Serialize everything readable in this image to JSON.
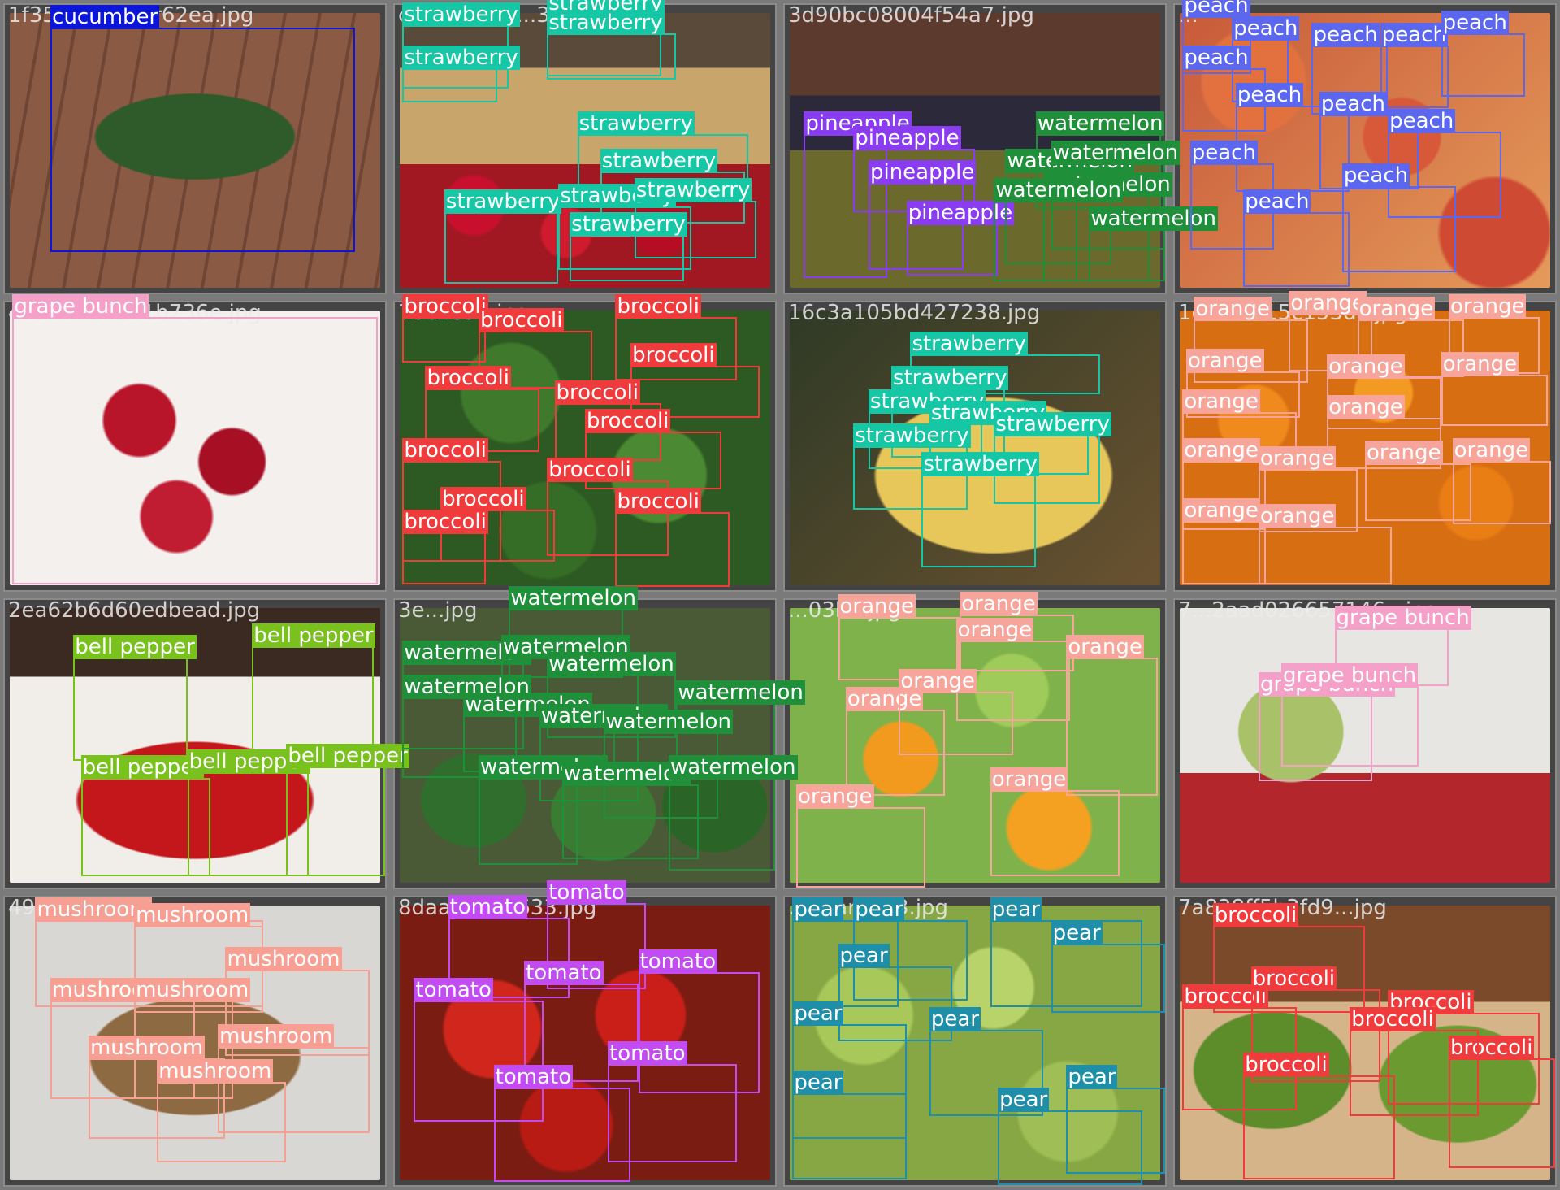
{
  "colors": {
    "cucumber": "#0b16d8",
    "strawberry": "#16c7a6",
    "pineapple": "#8a3cf0",
    "watermelon": "#1f8f3a",
    "peach": "#5b67ef",
    "grape bunch": "#f5a0c8",
    "broccoli": "#ef3b3b",
    "orange": "#f7a49a",
    "bell pepper": "#79c21e",
    "mushroom": "#f79f92",
    "tomato": "#c24cf2",
    "pear": "#1f8ea8"
  },
  "tiles": [
    {
      "filename": "1f35cucumber62ea.jpg",
      "labels": [
        {
          "text": "cucumber",
          "cls": "cucumber"
        }
      ]
    },
    {
      "filename": "c41064a5a...3.jpg",
      "labels": [
        {
          "text": "strawberry",
          "cls": "strawberry"
        },
        {
          "text": "strawberry",
          "cls": "strawberry"
        },
        {
          "text": "strawberry",
          "cls": "strawberry"
        },
        {
          "text": "strawberry",
          "cls": "strawberry"
        },
        {
          "text": "strawberry",
          "cls": "strawberry"
        },
        {
          "text": "strawberry",
          "cls": "strawberry"
        },
        {
          "text": "strawberry",
          "cls": "strawberry"
        },
        {
          "text": "strawberry",
          "cls": "strawberry"
        },
        {
          "text": "strawberry",
          "cls": "strawberry"
        },
        {
          "text": "strawberry",
          "cls": "strawberry"
        }
      ]
    },
    {
      "filename": "3d90bc08004f54a7.jpg",
      "labels": [
        {
          "text": "pineapple",
          "cls": "pineapple"
        },
        {
          "text": "pineapple",
          "cls": "pineapple"
        },
        {
          "text": "pineapple",
          "cls": "pineapple"
        },
        {
          "text": "pineapple",
          "cls": "pineapple"
        },
        {
          "text": "watermelon",
          "cls": "watermelon"
        },
        {
          "text": "watermelon",
          "cls": "watermelon"
        },
        {
          "text": "watermelon",
          "cls": "watermelon"
        },
        {
          "text": "watermelon",
          "cls": "watermelon"
        },
        {
          "text": "watermelon",
          "cls": "watermelon"
        },
        {
          "text": "watermelon",
          "cls": "watermelon"
        }
      ]
    },
    {
      "filename": "...",
      "labels": [
        {
          "text": "peach",
          "cls": "peach"
        },
        {
          "text": "peach",
          "cls": "peach"
        },
        {
          "text": "peach",
          "cls": "peach"
        },
        {
          "text": "peach",
          "cls": "peach"
        },
        {
          "text": "peach",
          "cls": "peach"
        },
        {
          "text": "peach",
          "cls": "peach"
        },
        {
          "text": "peach",
          "cls": "peach"
        },
        {
          "text": "peach",
          "cls": "peach"
        },
        {
          "text": "peach",
          "cls": "peach"
        },
        {
          "text": "peach",
          "cls": "peach"
        },
        {
          "text": "peach",
          "cls": "peach"
        },
        {
          "text": "peach",
          "cls": "peach"
        }
      ]
    },
    {
      "filename": "4a56b7242b1b736e.jpg",
      "labels": [
        {
          "text": "grape bunch",
          "cls": "grape bunch"
        }
      ]
    },
    {
      "filename": "78c2e9...jpg",
      "labels": [
        {
          "text": "broccoli",
          "cls": "broccoli"
        },
        {
          "text": "broccoli",
          "cls": "broccoli"
        },
        {
          "text": "broccoli",
          "cls": "broccoli"
        },
        {
          "text": "broccoli",
          "cls": "broccoli"
        },
        {
          "text": "broccoli",
          "cls": "broccoli"
        },
        {
          "text": "broccoli",
          "cls": "broccoli"
        },
        {
          "text": "broccoli",
          "cls": "broccoli"
        },
        {
          "text": "broccoli",
          "cls": "broccoli"
        },
        {
          "text": "broccoli",
          "cls": "broccoli"
        },
        {
          "text": "broccoli",
          "cls": "broccoli"
        },
        {
          "text": "broccoli",
          "cls": "broccoli"
        },
        {
          "text": "broccoli",
          "cls": "broccoli"
        }
      ]
    },
    {
      "filename": "16c3a105bd427238.jpg",
      "labels": [
        {
          "text": "strawberry",
          "cls": "strawberry"
        },
        {
          "text": "strawberry",
          "cls": "strawberry"
        },
        {
          "text": "strawberry",
          "cls": "strawberry"
        },
        {
          "text": "strawberry",
          "cls": "strawberry"
        },
        {
          "text": "strawberry",
          "cls": "strawberry"
        },
        {
          "text": "strawberry",
          "cls": "strawberry"
        },
        {
          "text": "strawberry",
          "cls": "strawberry"
        }
      ]
    },
    {
      "filename": "1c793bf15c153dc.jpg",
      "labels": [
        {
          "text": "orange",
          "cls": "orange"
        },
        {
          "text": "orange",
          "cls": "orange"
        },
        {
          "text": "orange",
          "cls": "orange"
        },
        {
          "text": "orange",
          "cls": "orange"
        },
        {
          "text": "orange",
          "cls": "orange"
        },
        {
          "text": "orange",
          "cls": "orange"
        },
        {
          "text": "orange",
          "cls": "orange"
        },
        {
          "text": "orange",
          "cls": "orange"
        },
        {
          "text": "orange",
          "cls": "orange"
        },
        {
          "text": "orange",
          "cls": "orange"
        },
        {
          "text": "orange",
          "cls": "orange"
        },
        {
          "text": "orange",
          "cls": "orange"
        },
        {
          "text": "orange",
          "cls": "orange"
        },
        {
          "text": "orange",
          "cls": "orange"
        },
        {
          "text": "orange",
          "cls": "orange"
        }
      ]
    },
    {
      "filename": "2ea62b6d60edbead.jpg",
      "labels": [
        {
          "text": "bell pepper",
          "cls": "bell pepper"
        },
        {
          "text": "bell pepper",
          "cls": "bell pepper"
        },
        {
          "text": "bell pepper",
          "cls": "bell pepper"
        },
        {
          "text": "bell pepper",
          "cls": "bell pepper"
        },
        {
          "text": "bell pepper",
          "cls": "bell pepper"
        }
      ]
    },
    {
      "filename": "3e...jpg",
      "labels": [
        {
          "text": "watermelon",
          "cls": "watermelon"
        },
        {
          "text": "watermelon",
          "cls": "watermelon"
        },
        {
          "text": "watermelon",
          "cls": "watermelon"
        },
        {
          "text": "watermelon",
          "cls": "watermelon"
        },
        {
          "text": "watermelon",
          "cls": "watermelon"
        },
        {
          "text": "watermelon",
          "cls": "watermelon"
        },
        {
          "text": "watermelon",
          "cls": "watermelon"
        },
        {
          "text": "watermelon",
          "cls": "watermelon"
        },
        {
          "text": "watermelon",
          "cls": "watermelon"
        },
        {
          "text": "watermelon",
          "cls": "watermelon"
        },
        {
          "text": "watermelon",
          "cls": "watermelon"
        },
        {
          "text": "watermelon",
          "cls": "watermelon"
        }
      ]
    },
    {
      "filename": "...03b...jpg",
      "labels": [
        {
          "text": "orange",
          "cls": "orange"
        },
        {
          "text": "orange",
          "cls": "orange"
        },
        {
          "text": "orange",
          "cls": "orange"
        },
        {
          "text": "orange",
          "cls": "orange"
        },
        {
          "text": "orange",
          "cls": "orange"
        },
        {
          "text": "orange",
          "cls": "orange"
        },
        {
          "text": "orange",
          "cls": "orange"
        },
        {
          "text": "orange",
          "cls": "orange"
        }
      ]
    },
    {
      "filename": "7...2aad026657146...jpg",
      "labels": [
        {
          "text": "grape bunch",
          "cls": "grape bunch"
        },
        {
          "text": "grape bunch",
          "cls": "grape bunch"
        },
        {
          "text": "grape bunch",
          "cls": "grape bunch"
        }
      ]
    },
    {
      "filename": "49...jpg",
      "labels": [
        {
          "text": "mushroom",
          "cls": "mushroom"
        },
        {
          "text": "mushroom",
          "cls": "mushroom"
        },
        {
          "text": "mushroom",
          "cls": "mushroom"
        },
        {
          "text": "mushroom",
          "cls": "mushroom"
        },
        {
          "text": "mushroom",
          "cls": "mushroom"
        },
        {
          "text": "mushroom",
          "cls": "mushroom"
        },
        {
          "text": "mushroom",
          "cls": "mushroom"
        },
        {
          "text": "mushroom",
          "cls": "mushroom"
        }
      ]
    },
    {
      "filename": "8daa...f2bc633.jpg",
      "labels": [
        {
          "text": "tomato",
          "cls": "tomato"
        },
        {
          "text": "tomato",
          "cls": "tomato"
        },
        {
          "text": "tomato",
          "cls": "tomato"
        },
        {
          "text": "tomato",
          "cls": "tomato"
        },
        {
          "text": "tomato",
          "cls": "tomato"
        },
        {
          "text": "tomato",
          "cls": "tomato"
        },
        {
          "text": "tomato",
          "cls": "tomato"
        }
      ]
    },
    {
      "filename": "...pear...f23.jpg",
      "labels": [
        {
          "text": "pear",
          "cls": "pear"
        },
        {
          "text": "pear",
          "cls": "pear"
        },
        {
          "text": "pear",
          "cls": "pear"
        },
        {
          "text": "pear",
          "cls": "pear"
        },
        {
          "text": "pear",
          "cls": "pear"
        },
        {
          "text": "pear",
          "cls": "pear"
        },
        {
          "text": "pear",
          "cls": "pear"
        },
        {
          "text": "pear",
          "cls": "pear"
        },
        {
          "text": "pear",
          "cls": "pear"
        },
        {
          "text": "pear",
          "cls": "pear"
        }
      ]
    },
    {
      "filename": "7a828ff5b3fd9...jpg",
      "labels": [
        {
          "text": "broccoli",
          "cls": "broccoli"
        },
        {
          "text": "broccoli",
          "cls": "broccoli"
        },
        {
          "text": "broccoli",
          "cls": "broccoli"
        },
        {
          "text": "broccoli",
          "cls": "broccoli"
        },
        {
          "text": "broccoli",
          "cls": "broccoli"
        },
        {
          "text": "broccoli",
          "cls": "broccoli"
        },
        {
          "text": "broccoli",
          "cls": "broccoli"
        }
      ]
    }
  ]
}
